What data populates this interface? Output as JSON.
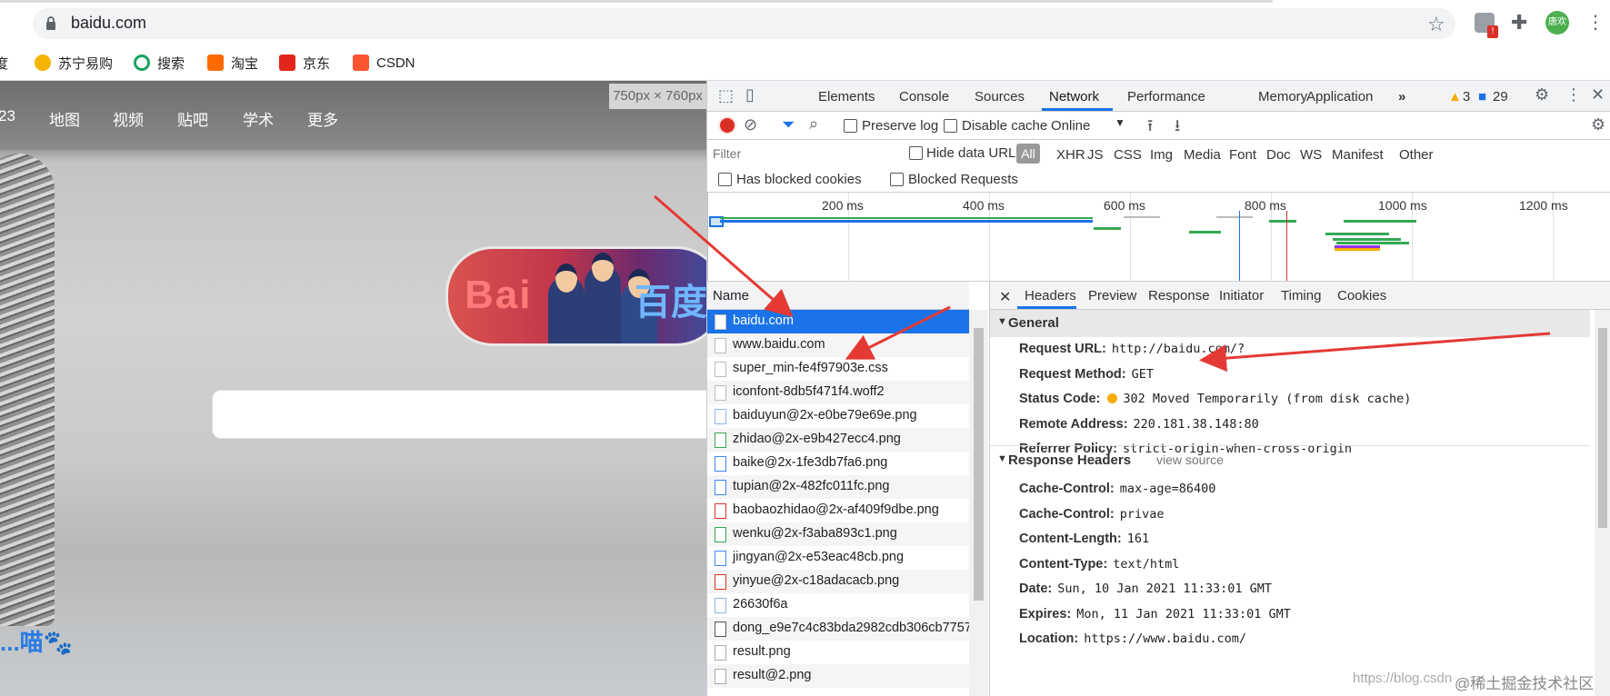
{
  "browser": {
    "url": "baidu.com",
    "avatar_text": "唐欢",
    "ext_badge": "!"
  },
  "bookmarks": [
    {
      "label": "度",
      "icon": "baidu-icon",
      "color": "#2b66d9"
    },
    {
      "label": "苏宁易购",
      "icon": "suning-icon",
      "color": "#f5b400"
    },
    {
      "label": "搜索",
      "icon": "search-engine-icon",
      "color": "#1aa260"
    },
    {
      "label": "淘宝",
      "icon": "taobao-icon",
      "color": "#ff6a00"
    },
    {
      "label": "京东",
      "icon": "jd-icon",
      "color": "#e1251b"
    },
    {
      "label": "CSDN",
      "icon": "csdn-icon",
      "color": "#fc5531"
    }
  ],
  "page": {
    "nav": [
      "23",
      "地图",
      "视频",
      "贴吧",
      "学术",
      "更多"
    ],
    "doodle_left": "Bai",
    "doodle_right": "百度",
    "paw_text": "...喵🐾",
    "dimensions": "750px × 760px"
  },
  "devtools": {
    "tabs": [
      "Elements",
      "Console",
      "Sources",
      "Network",
      "Performance",
      "Memory",
      "Application"
    ],
    "more": "»",
    "warnings": "3",
    "messages": "29",
    "toolbar": {
      "preserve_log": "Preserve log",
      "disable_cache": "Disable cache",
      "throttle": "Online"
    },
    "filter": {
      "placeholder": "Filter",
      "hide_data_urls": "Hide data URLs",
      "all": "All",
      "types": [
        "XHR",
        "JS",
        "CSS",
        "Img",
        "Media",
        "Font",
        "Doc",
        "WS",
        "Manifest",
        "Other"
      ]
    },
    "blocked": {
      "has_blocked_cookies": "Has blocked cookies",
      "blocked_requests": "Blocked Requests"
    },
    "timeline_ticks": [
      "200 ms",
      "400 ms",
      "600 ms",
      "800 ms",
      "1000 ms",
      "1200 ms"
    ],
    "name_header": "Name",
    "requests": [
      "baidu.com",
      "www.baidu.com",
      "super_min-fe4f97903e.css",
      "iconfont-8db5f471f4.woff2",
      "baiduyun@2x-e0be79e69e.png",
      "zhidao@2x-e9b427ecc4.png",
      "baike@2x-1fe3db7fa6.png",
      "tupian@2x-482fc011fc.png",
      "baobaozhidao@2x-af409f9dbe.png",
      "wenku@2x-f3aba893c1.png",
      "jingyan@2x-e53eac48cb.png",
      "yinyue@2x-c18adacacb.png",
      "26630f6a",
      "dong_e9e7c4c83bda2982cdb306cb7757",
      "result.png",
      "result@2.png"
    ],
    "detail_tabs": [
      "Headers",
      "Preview",
      "Response",
      "Initiator",
      "Timing",
      "Cookies"
    ],
    "general_title": "General",
    "general": [
      {
        "k": "Request URL:",
        "v": "http://baidu.com/?"
      },
      {
        "k": "Request Method:",
        "v": "GET"
      },
      {
        "k": "Status Code:",
        "v": "302 Moved Temporarily (from disk cache)"
      },
      {
        "k": "Remote Address:",
        "v": "220.181.38.148:80"
      },
      {
        "k": "Referrer Policy:",
        "v": "strict-origin-when-cross-origin"
      }
    ],
    "response_title": "Response Headers",
    "view_source": "view source",
    "response_headers": [
      {
        "k": "Cache-Control:",
        "v": "max-age=86400"
      },
      {
        "k": "Cache-Control:",
        "v": "privae"
      },
      {
        "k": "Content-Length:",
        "v": "161"
      },
      {
        "k": "Content-Type:",
        "v": "text/html"
      },
      {
        "k": "Date:",
        "v": "Sun, 10 Jan 2021 11:33:01 GMT"
      },
      {
        "k": "Expires:",
        "v": "Mon, 11 Jan 2021 11:33:01 GMT"
      },
      {
        "k": "Location:",
        "v": "https://www.baidu.com/"
      }
    ]
  },
  "watermark": {
    "faint": "https://blog.csdn",
    "main": "@稀土掘金技术社区"
  },
  "colors": {
    "accent": "#1a73e8",
    "record": "#d93025",
    "arrow": "#e53935"
  }
}
